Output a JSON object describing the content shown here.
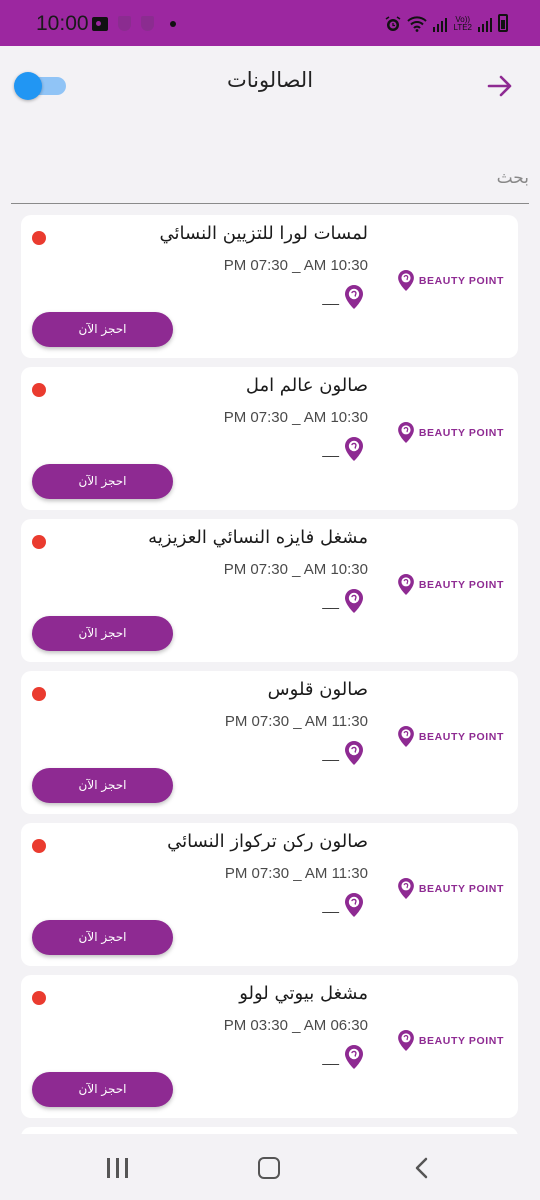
{
  "status_bar": {
    "time": "10:00",
    "volte_line1": "Vo))",
    "volte_line2": "LTE2"
  },
  "header": {
    "title": "الصالونات",
    "toggle_on": true
  },
  "search": {
    "placeholder": "بحث",
    "value": ""
  },
  "colors": {
    "brand_purple": "#8e2a92",
    "status_bar": "#9c27a0",
    "closed_dot": "#ea3b2f",
    "toggle_blue": "#2196f3"
  },
  "salons": [
    {
      "name": "لمسات لورا للتزيين النسائي",
      "hours": "PM 07:30 _ AM 10:30",
      "location": "__",
      "book_label": "احجز الآن",
      "logo_text": "BEAUTY POINT",
      "status": "closed"
    },
    {
      "name": "صالون عالم امل",
      "hours": "PM 07:30 _ AM 10:30",
      "location": "__",
      "book_label": "احجز الآن",
      "logo_text": "BEAUTY POINT",
      "status": "closed"
    },
    {
      "name": "مشغل فايزه النسائي العزيزيه",
      "hours": "PM 07:30 _ AM 10:30",
      "location": "__",
      "book_label": "احجز الآن",
      "logo_text": "BEAUTY POINT",
      "status": "closed"
    },
    {
      "name": "صالون قلوس",
      "hours": "PM 07:30 _ AM 11:30",
      "location": "__",
      "book_label": "احجز الآن",
      "logo_text": "BEAUTY POINT",
      "status": "closed"
    },
    {
      "name": "صالون ركن تركواز النسائي",
      "hours": "PM 07:30 _ AM 11:30",
      "location": "__",
      "book_label": "احجز الآن",
      "logo_text": "BEAUTY POINT",
      "status": "closed"
    },
    {
      "name": "مشغل بيوتي لولو",
      "hours": "PM 03:30 _ AM 06:30",
      "location": "__",
      "book_label": "احجز الآن",
      "logo_text": "BEAUTY POINT",
      "status": "closed"
    }
  ]
}
